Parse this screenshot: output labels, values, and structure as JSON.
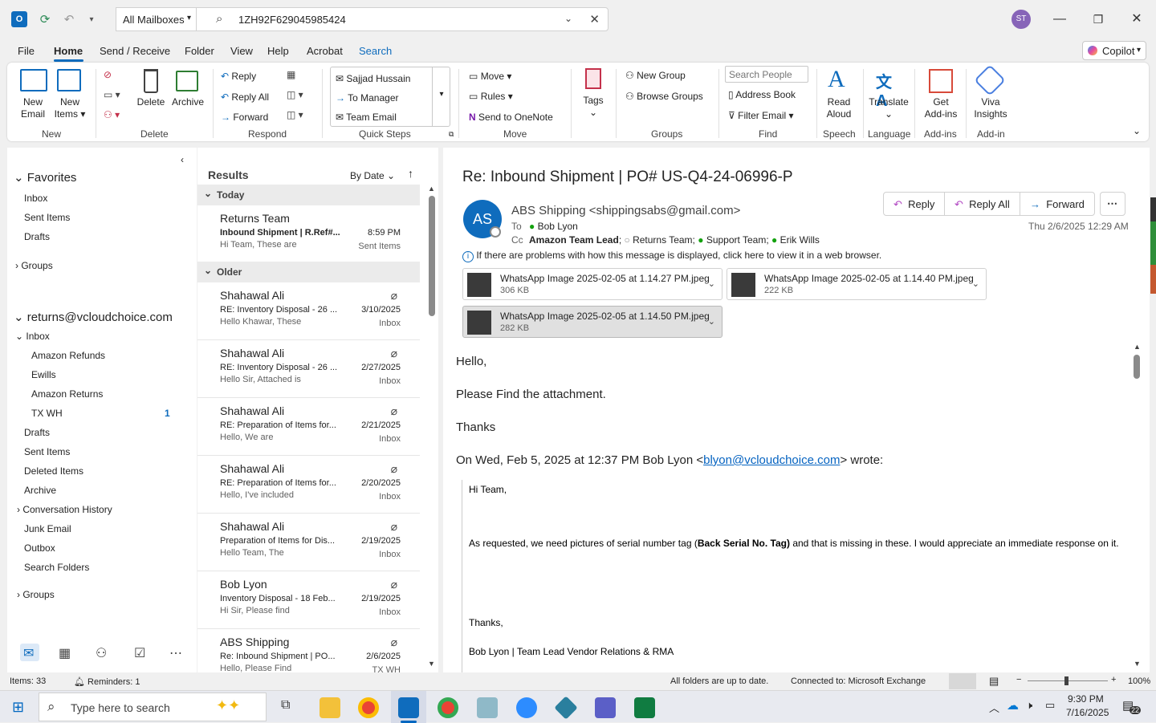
{
  "titlebar": {
    "mailbox_filter": "All Mailboxes",
    "search_query": "1ZH92F629045985424",
    "user_initials": "ST"
  },
  "menu": {
    "tabs": [
      "File",
      "Home",
      "Send / Receive",
      "Folder",
      "View",
      "Help",
      "Acrobat",
      "Search"
    ],
    "active": "Home",
    "copilot": "Copilot"
  },
  "ribbon": {
    "new_email": [
      "New",
      "Email"
    ],
    "new_items": [
      "New",
      "Items"
    ],
    "group_new": "New",
    "delete": "Delete",
    "archive": "Archive",
    "group_delete": "Delete",
    "reply": "Reply",
    "reply_all": "Reply All",
    "forward": "Forward",
    "group_respond": "Respond",
    "qs1": "Sajjad Hussain",
    "qs2": "To Manager",
    "qs3": "Team Email",
    "group_quicksteps": "Quick Steps",
    "move": "Move",
    "rules": "Rules",
    "onenote": "Send to OneNote",
    "group_move": "Move",
    "tags": "Tags",
    "new_group": "New Group",
    "browse_groups": "Browse Groups",
    "group_groups": "Groups",
    "search_people_placeholder": "Search People",
    "address_book": "Address Book",
    "filter_email": "Filter Email",
    "group_find": "Find",
    "read_aloud": [
      "Read",
      "Aloud"
    ],
    "group_speech": "Speech",
    "translate": "Translate",
    "group_language": "Language",
    "get_addins": [
      "Get",
      "Add-ins"
    ],
    "group_addins": "Add-ins",
    "viva": [
      "Viva",
      "Insights"
    ],
    "group_addin": "Add-in"
  },
  "nav": {
    "favorites": "Favorites",
    "fav_items": [
      "Inbox",
      "Sent Items",
      "Drafts"
    ],
    "groups1": "Groups",
    "account": "returns@vcloudchoice.com",
    "inbox": "Inbox",
    "inbox_sub": [
      "Amazon Refunds",
      "Ewills",
      "Amazon Returns",
      "TX WH"
    ],
    "txwh_count": "1",
    "folders": [
      "Drafts",
      "Sent Items",
      "Deleted Items",
      "Archive",
      "Conversation History",
      "Junk Email",
      "Outbox",
      "Search Folders"
    ],
    "groups2": "Groups"
  },
  "list": {
    "header": "Results",
    "sort": "By Date",
    "section_today": "Today",
    "section_older": "Older",
    "today": [
      {
        "sender": "Returns Team",
        "subject": "Inbound Shipment | R.Ref#...",
        "preview": "Hi Team,  These are",
        "date": "8:59 PM",
        "folder": "Sent Items"
      }
    ],
    "older": [
      {
        "sender": "Shahawal Ali",
        "subject": "RE: Inventory Disposal - 26 ...",
        "preview": "Hello Khawar,  These",
        "date": "3/10/2025",
        "folder": "Inbox"
      },
      {
        "sender": "Shahawal Ali",
        "subject": "RE: Inventory Disposal - 26 ...",
        "preview": "Hello Sir,  Attached is",
        "date": "2/27/2025",
        "folder": "Inbox"
      },
      {
        "sender": "Shahawal Ali",
        "subject": "RE: Preparation of Items for...",
        "preview": "Hello,  We are",
        "date": "2/21/2025",
        "folder": "Inbox"
      },
      {
        "sender": "Shahawal Ali",
        "subject": "RE: Preparation of Items for...",
        "preview": "Hello,  I've included",
        "date": "2/20/2025",
        "folder": "Inbox"
      },
      {
        "sender": "Shahawal Ali",
        "subject": "Preparation of Items for Dis...",
        "preview": "Hello Team,  The",
        "date": "2/19/2025",
        "folder": "Inbox"
      },
      {
        "sender": "Bob Lyon",
        "subject": "Inventory Disposal - 18 Feb...",
        "preview": "Hi Sir,  Please find",
        "date": "2/19/2025",
        "folder": "Inbox"
      },
      {
        "sender": "ABS Shipping",
        "subject": "Re: Inbound Shipment | PO...",
        "preview": "Hello,  Please Find",
        "date": "2/6/2025",
        "folder": "TX WH"
      }
    ]
  },
  "message": {
    "subject": "Re: Inbound Shipment | PO# US-Q4-24-06996-P",
    "avatar": "AS",
    "from": "ABS Shipping <shippingsabs@gmail.com>",
    "to_label": "To",
    "to": "Bob Lyon",
    "cc_label": "Cc",
    "cc1": "Amazon Team Lead",
    "cc2": "Returns Team;",
    "cc3": "Support Team;",
    "cc4": "Erik Wills",
    "date": "Thu 2/6/2025 12:29 AM",
    "reply": "Reply",
    "reply_all": "Reply All",
    "forward": "Forward",
    "info": "If there are problems with how this message is displayed, click here to view it in a web browser.",
    "attachments": [
      {
        "name": "WhatsApp Image 2025-02-05 at 1.14.27 PM.jpeg",
        "size": "306 KB"
      },
      {
        "name": "WhatsApp Image 2025-02-05 at 1.14.40 PM.jpeg",
        "size": "222 KB"
      },
      {
        "name": "WhatsApp Image 2025-02-05 at 1.14.50 PM.jpeg",
        "size": "282 KB"
      }
    ],
    "body1": "Hello,",
    "body2": "Please Find the attachment.",
    "body3": "Thanks",
    "quote_intro_pre": "On Wed, Feb 5, 2025 at 12:37 PM Bob Lyon <",
    "quote_email": "blyon@vcloudchoice.com",
    "quote_intro_post": "> wrote:",
    "q1": "Hi Team,",
    "q2_pre": "As requested, we need pictures of serial number tag (",
    "q2_bold": "Back Serial No. Tag)",
    "q2_post": " and that is missing in these. I would appreciate an immediate response on it.",
    "q3": "Thanks,",
    "q4": "Bob Lyon | Team Lead Vendor Relations & RMA"
  },
  "status": {
    "items": "Items: 33",
    "reminders": "Reminders: 1",
    "sync": "All folders are up to date.",
    "connected": "Connected to: Microsoft Exchange",
    "zoom": "100%"
  },
  "taskbar": {
    "search_placeholder": "Type here to search",
    "time": "9:30 PM",
    "date": "7/16/2025",
    "notif_count": "22"
  },
  "colors": {
    "accent": "#0f6cbd",
    "avatar": "#0f6cbd",
    "user_avatar": "#8764b8"
  }
}
